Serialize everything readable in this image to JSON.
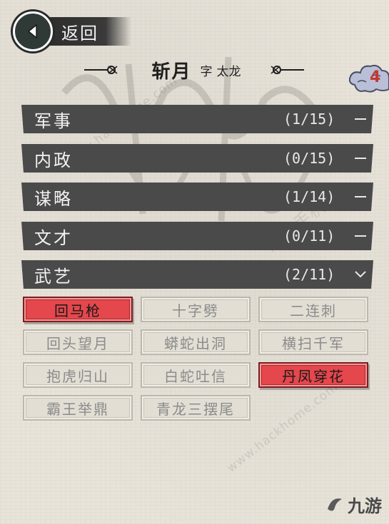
{
  "header": {
    "back_label": "返回"
  },
  "general": {
    "name": "斩月",
    "zi_label": "字",
    "alias": "太龙"
  },
  "badge": {
    "count": "4"
  },
  "categories": [
    {
      "name": "军事",
      "progress": "(1/15)"
    },
    {
      "name": "内政",
      "progress": "(0/15)"
    },
    {
      "name": "谋略",
      "progress": "(1/14)"
    },
    {
      "name": "文才",
      "progress": "(0/11)"
    },
    {
      "name": "武艺",
      "progress": "(2/11)"
    }
  ],
  "skills": [
    {
      "label": "回马枪",
      "learned": true
    },
    {
      "label": "十字劈",
      "learned": false
    },
    {
      "label": "二连刺",
      "learned": false
    },
    {
      "label": "回头望月",
      "learned": false
    },
    {
      "label": "蟒蛇出洞",
      "learned": false
    },
    {
      "label": "横扫千军",
      "learned": false
    },
    {
      "label": "抱虎归山",
      "learned": false
    },
    {
      "label": "白蛇吐信",
      "learned": false
    },
    {
      "label": "丹凤穿花",
      "learned": true
    },
    {
      "label": "霸王举鼎",
      "learned": false
    },
    {
      "label": "青龙三摆尾",
      "learned": false
    }
  ],
  "watermarks": {
    "site": "www.hackhome.com",
    "site_cn": "海客手机站",
    "brand": "九游"
  },
  "colors": {
    "learned": "#e4474c",
    "badge_count": "#c43a33",
    "category_bar": "#4a4a4a"
  }
}
